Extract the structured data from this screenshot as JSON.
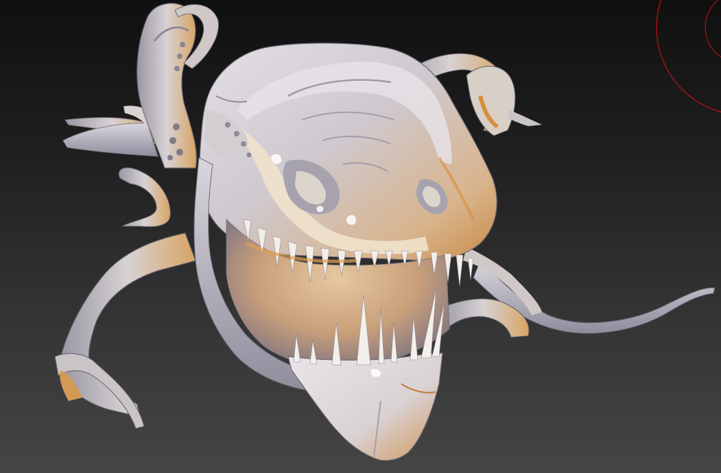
{
  "viewport": {
    "background_top": "#101010",
    "background_bottom": "#454545",
    "material_base": "#d6d2d6",
    "material_highlight": "#f1ede7",
    "material_shadow": "#7f7c8a",
    "material_warm": "#d8964a",
    "gizmo_color": "#c01818"
  },
  "model": {
    "icon": "creature-sculpt-icon"
  },
  "navigation_gizmo": {
    "icon": "rotation-gizmo-icon"
  }
}
